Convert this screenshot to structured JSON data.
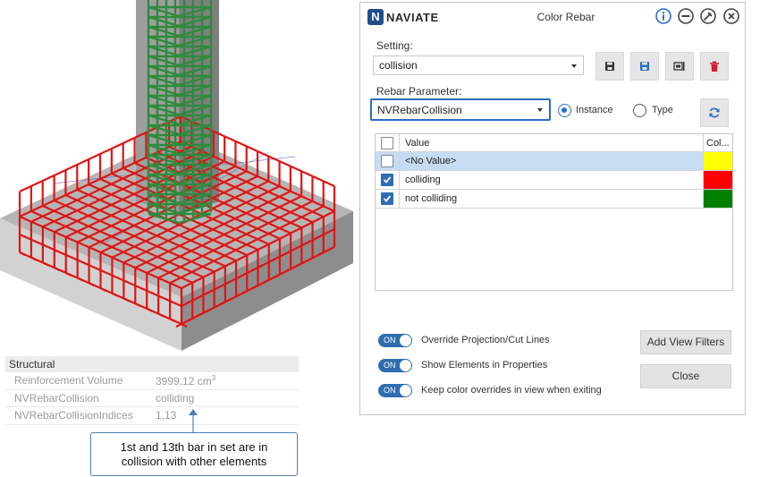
{
  "properties": {
    "header": "Structural",
    "rows": [
      {
        "key": "Reinforcement Volume",
        "value": "3999.12 cm",
        "sup": "3"
      },
      {
        "key": "NVRebarCollision",
        "value": "colliding",
        "sup": ""
      },
      {
        "key": "NVRebarCollisionIndices",
        "value": "1,13",
        "sup": ""
      }
    ]
  },
  "callout": {
    "line1": "1st and 13th bar in set are in",
    "line2": "collision with other elements"
  },
  "dialog": {
    "brand_letter": "N",
    "brand": "NAVIATE",
    "title": "Color Rebar",
    "setting_label": "Setting:",
    "setting_value": "collision",
    "param_label": "Rebar Parameter:",
    "param_value": "NVRebarCollision",
    "radio_instance": "Instance",
    "radio_type": "Type",
    "grid_header_value": "Value",
    "grid_header_color": "Col...",
    "rows": [
      {
        "checked": false,
        "value": "<No Value>",
        "color": "#ffff00",
        "selected": true
      },
      {
        "checked": true,
        "value": "colliding",
        "color": "#ff0000",
        "selected": false
      },
      {
        "checked": true,
        "value": "not colliding",
        "color": "#008000",
        "selected": false
      }
    ],
    "toggle_on": "ON",
    "toggles": [
      "Override Projection/Cut Lines",
      "Show Elements in Properties",
      "Keep color overrides in view when exiting"
    ],
    "add_filters_label": "Add View Filters",
    "close_label": "Close",
    "icons": [
      "info-icon",
      "minimize-icon",
      "pin-icon",
      "close-icon",
      "save-icon",
      "save-as-icon",
      "rename-icon",
      "delete-icon",
      "refresh-icon"
    ]
  }
}
